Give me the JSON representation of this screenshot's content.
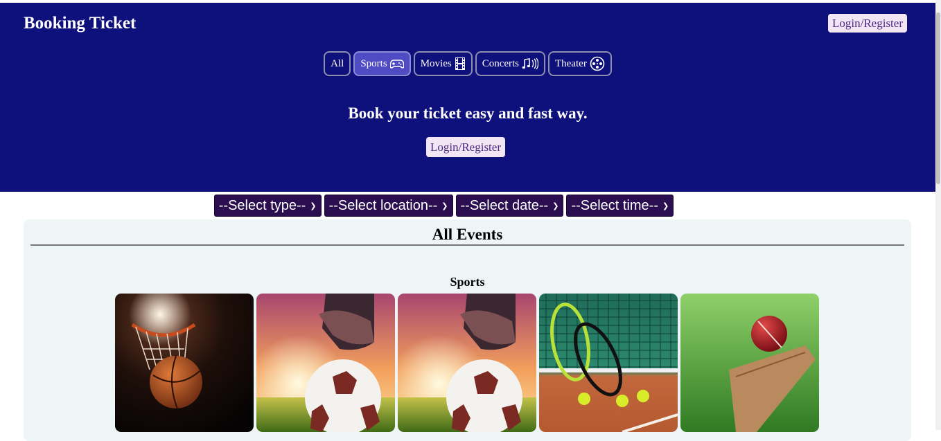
{
  "header": {
    "brand": "Booking Ticket",
    "login_label": "Login/Register",
    "headline": "Book your ticket easy and fast way.",
    "cta_label": "Login/Register"
  },
  "tabs": [
    {
      "label": "All",
      "icon": "none"
    },
    {
      "label": "Sports",
      "icon": "gamepad-icon",
      "active": true
    },
    {
      "label": "Movies",
      "icon": "film-icon"
    },
    {
      "label": "Concerts",
      "icon": "music-note-icon"
    },
    {
      "label": "Theater",
      "icon": "film-reel-icon"
    }
  ],
  "filters": [
    {
      "label": "--Select type--"
    },
    {
      "label": "--Select location--"
    },
    {
      "label": "--Select date--"
    },
    {
      "label": "--Select time--"
    }
  ],
  "events": {
    "title": "All Events",
    "sections": [
      {
        "title": "Sports",
        "cards": [
          {
            "image": "basketball-hoop-photo"
          },
          {
            "image": "soccer-ball-sunset-photo"
          },
          {
            "image": "soccer-ball-sunset-photo"
          },
          {
            "image": "tennis-rackets-photo"
          },
          {
            "image": "cricket-ball-bat-photo"
          }
        ]
      }
    ]
  },
  "colors": {
    "header_bg": "#0e107b",
    "active_tab": "#4f4bc3",
    "filter_bg": "#2a0e50",
    "panel_bg": "#edf5f7",
    "button_bg": "#f2e6f4",
    "button_text": "#4b2a85"
  }
}
